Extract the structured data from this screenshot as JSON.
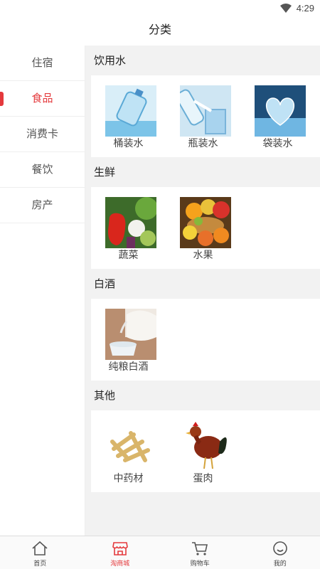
{
  "status_bar": {
    "time": "4:29"
  },
  "header": {
    "title": "分类"
  },
  "sidebar": {
    "items": [
      {
        "label": "住宿"
      },
      {
        "label": "食品"
      },
      {
        "label": "消费卡"
      },
      {
        "label": "餐饮"
      },
      {
        "label": "房产"
      }
    ],
    "active_index": 1
  },
  "sections": [
    {
      "title": "饮用水",
      "items": [
        {
          "label": "桶装水"
        },
        {
          "label": "瓶装水"
        },
        {
          "label": "袋装水"
        }
      ]
    },
    {
      "title": "生鲜",
      "items": [
        {
          "label": "蔬菜"
        },
        {
          "label": "水果"
        }
      ]
    },
    {
      "title": "白酒",
      "items": [
        {
          "label": "纯粮白酒"
        }
      ]
    },
    {
      "title": "其他",
      "items": [
        {
          "label": "中药材"
        },
        {
          "label": "蛋肉"
        }
      ]
    }
  ],
  "tabbar": {
    "items": [
      {
        "label": "首页",
        "icon": "home-icon"
      },
      {
        "label": "淘商城",
        "icon": "shop-icon"
      },
      {
        "label": "购物车",
        "icon": "cart-icon"
      },
      {
        "label": "我的",
        "icon": "profile-icon"
      }
    ],
    "active_index": 1
  },
  "colors": {
    "accent": "#e4393c",
    "content_bg": "#f2f2f2"
  }
}
